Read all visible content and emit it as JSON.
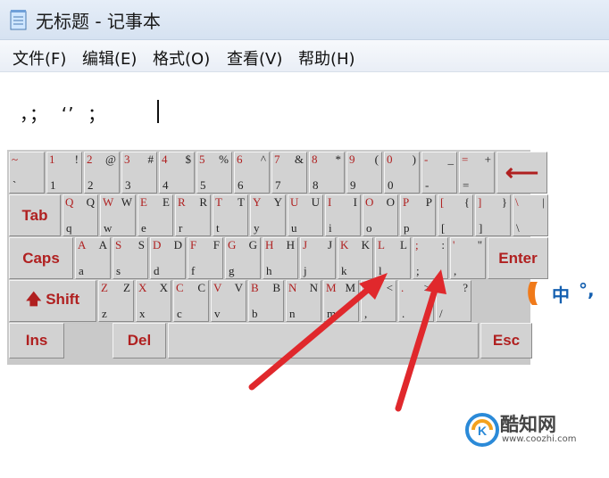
{
  "window": {
    "title": "无标题 - 记事本"
  },
  "menu": [
    "文件(F)",
    "编辑(E)",
    "格式(O)",
    "查看(V)",
    "帮助(H)"
  ],
  "editor": {
    "content": "，；  ‘’  ；"
  },
  "keyboard": {
    "rows": [
      [
        {
          "top": "~",
          "bottom": "`"
        },
        {
          "top": "1",
          "tr": "!",
          "bottom": "1"
        },
        {
          "top": "2",
          "tr": "@",
          "bottom": "2"
        },
        {
          "top": "3",
          "tr": "#",
          "bottom": "3"
        },
        {
          "top": "4",
          "tr": "$",
          "bottom": "4"
        },
        {
          "top": "5",
          "tr": "%",
          "bottom": "5"
        },
        {
          "top": "6",
          "tr": "^",
          "bottom": "6"
        },
        {
          "top": "7",
          "tr": "&",
          "bottom": "7"
        },
        {
          "top": "8",
          "tr": "*",
          "bottom": "8"
        },
        {
          "top": "9",
          "tr": "(",
          "bottom": "9"
        },
        {
          "top": "0",
          "tr": ")",
          "bottom": "0"
        },
        {
          "top": "-",
          "tr": "_",
          "bottom": "-"
        },
        {
          "top": "=",
          "tr": "+",
          "bottom": "="
        },
        {
          "label": "⟵",
          "name": "backspace-key"
        }
      ],
      [
        {
          "label": "Tab",
          "name": "tab-key"
        },
        {
          "top": "Q",
          "tr": "Q",
          "bottom": "q"
        },
        {
          "top": "W",
          "tr": "W",
          "bottom": "w"
        },
        {
          "top": "E",
          "tr": "E",
          "bottom": "e"
        },
        {
          "top": "R",
          "tr": "R",
          "bottom": "r"
        },
        {
          "top": "T",
          "tr": "T",
          "bottom": "t"
        },
        {
          "top": "Y",
          "tr": "Y",
          "bottom": "y"
        },
        {
          "top": "U",
          "tr": "U",
          "bottom": "u"
        },
        {
          "top": "I",
          "tr": "I",
          "bottom": "i"
        },
        {
          "top": "O",
          "tr": "O",
          "bottom": "o"
        },
        {
          "top": "P",
          "tr": "P",
          "bottom": "p"
        },
        {
          "top": "[",
          "tr": "{",
          "bottom": "["
        },
        {
          "top": "]",
          "tr": "}",
          "bottom": "]"
        },
        {
          "top": "\\",
          "tr": "|",
          "bottom": "\\"
        }
      ],
      [
        {
          "label": "Caps",
          "name": "caps-key"
        },
        {
          "top": "A",
          "tr": "A",
          "bottom": "a"
        },
        {
          "top": "S",
          "tr": "S",
          "bottom": "s"
        },
        {
          "top": "D",
          "tr": "D",
          "bottom": "d"
        },
        {
          "top": "F",
          "tr": "F",
          "bottom": "f"
        },
        {
          "top": "G",
          "tr": "G",
          "bottom": "g"
        },
        {
          "top": "H",
          "tr": "H",
          "bottom": "h"
        },
        {
          "top": "J",
          "tr": "J",
          "bottom": "j"
        },
        {
          "top": "K",
          "tr": "K",
          "bottom": "k"
        },
        {
          "top": "L",
          "tr": "L",
          "bottom": "l"
        },
        {
          "top": ";",
          "tr": ":",
          "bottom": ";"
        },
        {
          "top": "'",
          "tr": "\"",
          "bottom": ","
        },
        {
          "label": "Enter",
          "name": "enter-key"
        }
      ],
      [
        {
          "label": "Shift",
          "name": "shift-key"
        },
        {
          "top": "Z",
          "tr": "Z",
          "bottom": "z"
        },
        {
          "top": "X",
          "tr": "X",
          "bottom": "x"
        },
        {
          "top": "C",
          "tr": "C",
          "bottom": "c"
        },
        {
          "top": "V",
          "tr": "V",
          "bottom": "v"
        },
        {
          "top": "B",
          "tr": "B",
          "bottom": "b"
        },
        {
          "top": "N",
          "tr": "N",
          "bottom": "n"
        },
        {
          "top": "M",
          "tr": "M",
          "bottom": "m"
        },
        {
          "top": ",",
          "tr": "<",
          "bottom": ","
        },
        {
          "top": ".",
          "tr": ">",
          "bottom": "."
        },
        {
          "top": "/",
          "tr": "?",
          "bottom": "/"
        }
      ],
      [
        {
          "label": "Ins",
          "name": "ins-key"
        },
        {
          "label": "Del",
          "name": "del-key"
        },
        {
          "label": "",
          "name": "space-key"
        },
        {
          "label": "Esc",
          "name": "esc-key"
        }
      ]
    ]
  },
  "ime": {
    "mode": "中",
    "punct": "°,"
  },
  "watermark": {
    "name": "酷知网",
    "url": "www.coozhi.com"
  },
  "colors": {
    "key_legend": "#b02020",
    "arrow": "#e0282c"
  }
}
